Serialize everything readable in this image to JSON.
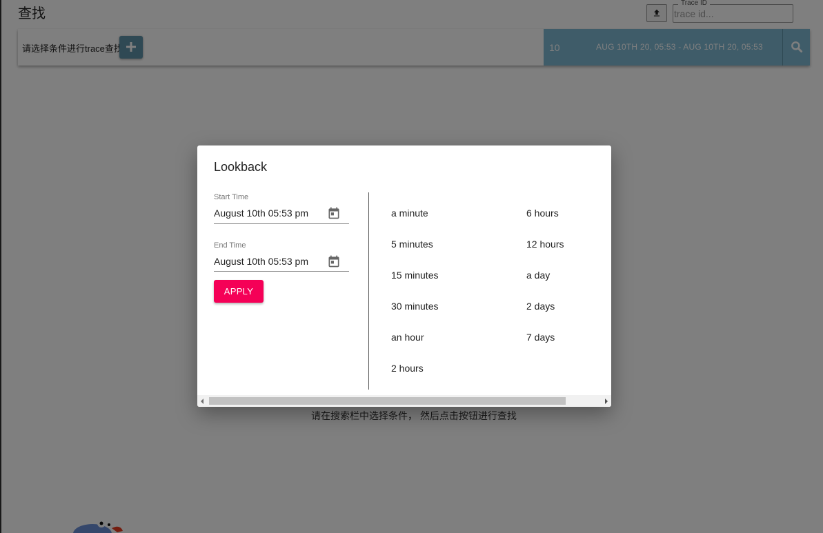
{
  "page": {
    "title": "查找",
    "empty_hint": "请在搜索栏中选择条件， 然后点击按钮进行查找"
  },
  "trace_lookup": {
    "legend": "Trace ID",
    "placeholder": "trace id..."
  },
  "search_bar": {
    "hint": "请选择条件进行trace查找",
    "limit": "10",
    "time_range": "AUG 10TH 20, 05:53 - AUG 10TH 20, 05:53"
  },
  "dialog": {
    "title": "Lookback",
    "start": {
      "label": "Start Time",
      "value": "August 10th 05:53 pm"
    },
    "end": {
      "label": "End Time",
      "value": "August 10th 05:53 pm"
    },
    "apply_label": "APPLY",
    "presets_col1": [
      "a minute",
      "5 minutes",
      "15 minutes",
      "30 minutes",
      "an hour",
      "2 hours"
    ],
    "presets_col2": [
      "6 hours",
      "12 hours",
      "a day",
      "2 days",
      "7 days"
    ]
  },
  "colors": {
    "accent": "#f50057",
    "bar_panel": "#7fb8d2",
    "button": "#5f93a8"
  },
  "icons": [
    "upload-icon",
    "plus-icon",
    "search-icon",
    "calendar-icon"
  ]
}
